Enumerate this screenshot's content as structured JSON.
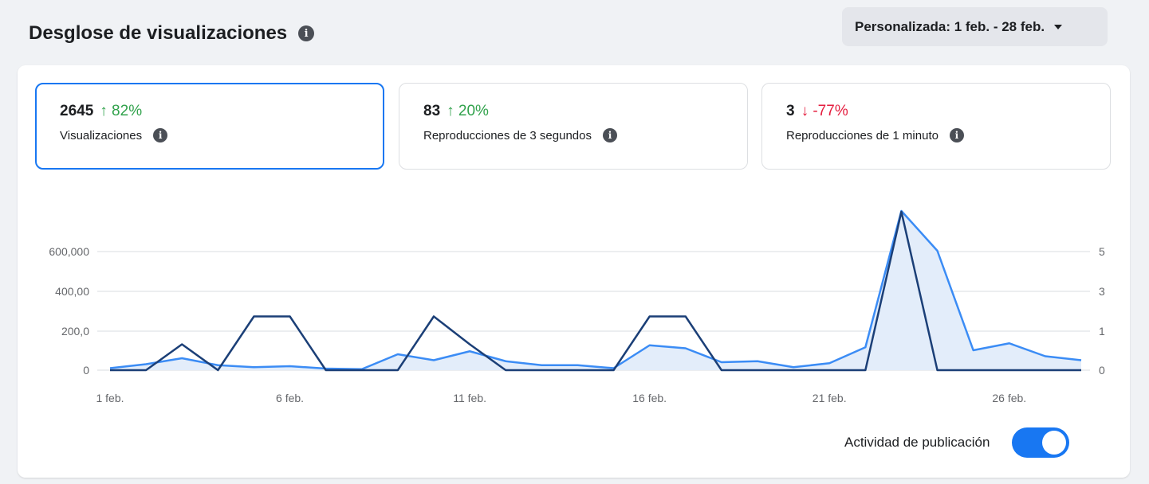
{
  "header": {
    "title": "Desglose de visualizaciones",
    "info_icon": "info-icon",
    "date_range": "Personalizada: 1 feb. - 28 feb.",
    "dropdown_icon": "caret-down-icon"
  },
  "metrics": [
    {
      "value": "2645",
      "change": "↑ 82%",
      "direction": "up",
      "label": "Visualizaciones",
      "selected": true
    },
    {
      "value": "83",
      "change": "↑ 20%",
      "direction": "up",
      "label": "Reproducciones de 3 segundos",
      "selected": false
    },
    {
      "value": "3",
      "change": "↓ -77%",
      "direction": "down",
      "label": "Reproducciones de 1 minuto",
      "selected": false
    }
  ],
  "colors": {
    "accent": "#1877f2",
    "views_line": "#3b8cf5",
    "views_fill": "#e3edfa",
    "activity_line": "#1b3f77",
    "up": "#31a24c",
    "down": "#e41e3f"
  },
  "chart_data": {
    "type": "line",
    "x": [
      "1 feb.",
      "2 feb.",
      "3 feb.",
      "4 feb.",
      "5 feb.",
      "6 feb.",
      "7 feb.",
      "8 feb.",
      "9 feb.",
      "10 feb.",
      "11 feb.",
      "12 feb.",
      "13 feb.",
      "14 feb.",
      "15 feb.",
      "16 feb.",
      "17 feb.",
      "18 feb.",
      "19 feb.",
      "20 feb.",
      "21 feb.",
      "22 feb.",
      "23 feb.",
      "24 feb.",
      "25 feb.",
      "26 feb.",
      "27 feb.",
      "28 feb."
    ],
    "x_tick_labels": [
      "1 feb.",
      "6 feb.",
      "11 feb.",
      "16 feb.",
      "21 feb.",
      "26 feb."
    ],
    "y_left_ticks": [
      "0",
      "200,0",
      "400,00",
      "600,000"
    ],
    "y_right_ticks": [
      "0",
      "1",
      "3",
      "5"
    ],
    "grid": true,
    "series": [
      {
        "axis": "left",
        "values": [
          10,
          30,
          60,
          25,
          15,
          20,
          8,
          5,
          80,
          50,
          95,
          45,
          25,
          25,
          10,
          125,
          110,
          40,
          45,
          15,
          35,
          115,
          800,
          600,
          100,
          135,
          70,
          50
        ]
      },
      {
        "axis": "right",
        "values": [
          0,
          0,
          1.3,
          0,
          2.7,
          2.7,
          0,
          0,
          0,
          2.7,
          1.3,
          0,
          0,
          0,
          0,
          2.7,
          2.7,
          0,
          0,
          0,
          0,
          0,
          8,
          0,
          0,
          0,
          0,
          0
        ]
      }
    ]
  },
  "toggle": {
    "label": "Actividad de publicación",
    "on": true
  }
}
